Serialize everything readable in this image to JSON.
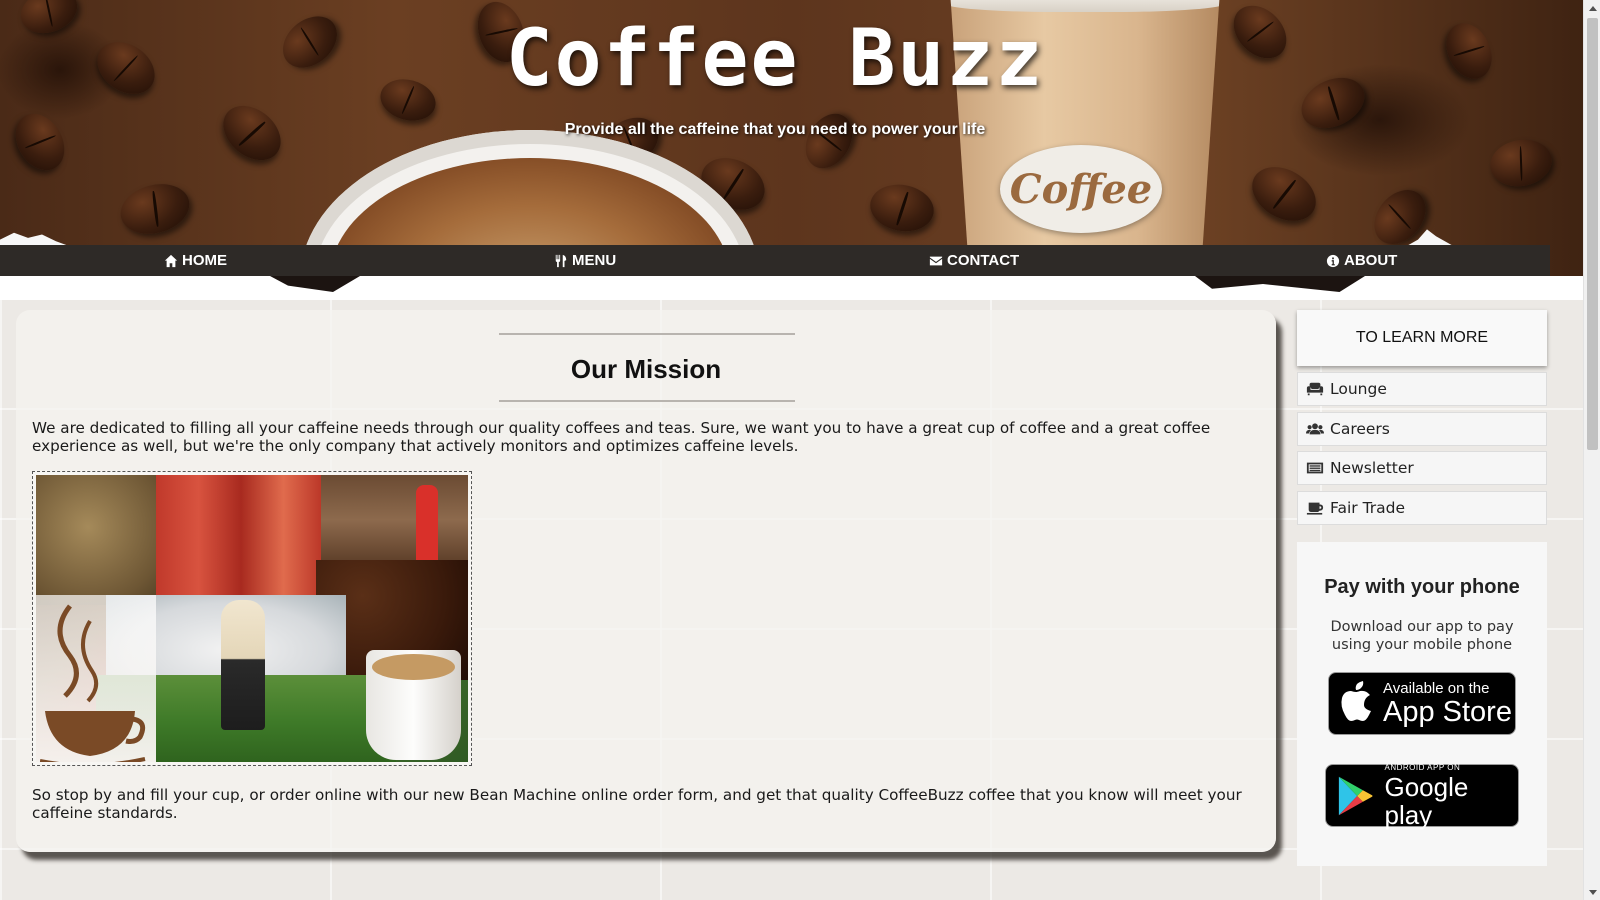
{
  "hero": {
    "title": "Coffee Buzz",
    "subtitle": "Provide all the caffeine that you need to power your life",
    "cup_badge_text": "Coffee"
  },
  "nav": {
    "items": [
      {
        "label": "HOME",
        "icon": "home-icon"
      },
      {
        "label": "MENU",
        "icon": "utensils-icon"
      },
      {
        "label": "CONTACT",
        "icon": "envelope-icon"
      },
      {
        "label": "ABOUT",
        "icon": "info-circle-icon"
      }
    ]
  },
  "main": {
    "heading": "Our Mission",
    "paragraph_1": "We are dedicated to filling all your caffeine needs through our quality coffees and teas. Sure, we want you to have a great cup of coffee and a great coffee experience as well, but we're the only company that actively monitors and optimizes caffeine levels.",
    "paragraph_2": "So stop by and fill your cup, or order online with our new Bean Machine online order form, and get that quality CoffeeBuzz coffee that you know will meet your caffeine standards."
  },
  "sidebar": {
    "header": "TO LEARN MORE",
    "links": [
      {
        "label": "Lounge",
        "icon": "couch-icon"
      },
      {
        "label": "Careers",
        "icon": "users-icon"
      },
      {
        "label": "Newsletter",
        "icon": "newspaper-icon"
      },
      {
        "label": "Fair Trade",
        "icon": "coffee-cup-icon"
      }
    ],
    "pay": {
      "title": "Pay with your phone",
      "text": "Download our app to pay using your mobile phone",
      "app_store_small": "Available on the",
      "app_store_big": "App Store",
      "google_play_small": "ANDROID APP ON",
      "google_play_big": "Google play"
    }
  },
  "colors": {
    "nav_bar": "#2e2a27",
    "panel_shadow": "#28231e",
    "page_bg": "#e9e6e2"
  }
}
